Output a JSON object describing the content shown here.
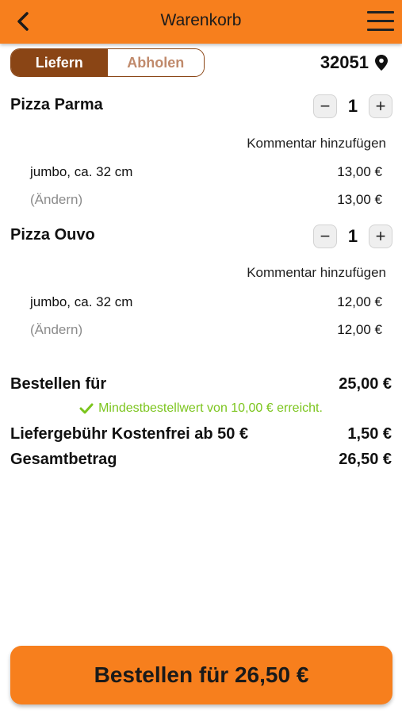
{
  "header": {
    "title": "Warenkorb",
    "back_icon": "chevron-left-icon",
    "menu_icon": "hamburger-menu-icon"
  },
  "mode_toggle": {
    "options": [
      "Liefern",
      "Abholen"
    ],
    "selected": "Liefern"
  },
  "location": {
    "zip": "32051",
    "icon": "map-pin-icon"
  },
  "items": [
    {
      "name": "Pizza Parma",
      "quantity": "1",
      "comment_label": "Kommentar hinzufügen",
      "option_label": "jumbo, ca. 32 cm",
      "option_price": "13,00 €",
      "edit_label": "(Ändern)",
      "item_total": "13,00 €"
    },
    {
      "name": "Pizza Ouvo",
      "quantity": "1",
      "comment_label": "Kommentar hinzufügen",
      "option_label": "jumbo, ca. 32 cm",
      "option_price": "12,00 €",
      "edit_label": "(Ändern)",
      "item_total": "12,00 €"
    }
  ],
  "summary": {
    "order_for_label": "Bestellen für",
    "order_for_value": "25,00 €",
    "min_order_notice": "Mindestbestellwert von 10,00 € erreicht.",
    "delivery_fee_label": "Liefergebühr Kostenfrei ab 50 €",
    "delivery_fee_value": "1,50 €",
    "total_label": "Gesamtbetrag",
    "total_value": "26,50 €"
  },
  "order_button": {
    "label": "Bestellen für 26,50 €"
  },
  "colors": {
    "accent": "#f77f1d",
    "toggle_active": "#8a4515",
    "success": "#7cc51e"
  }
}
